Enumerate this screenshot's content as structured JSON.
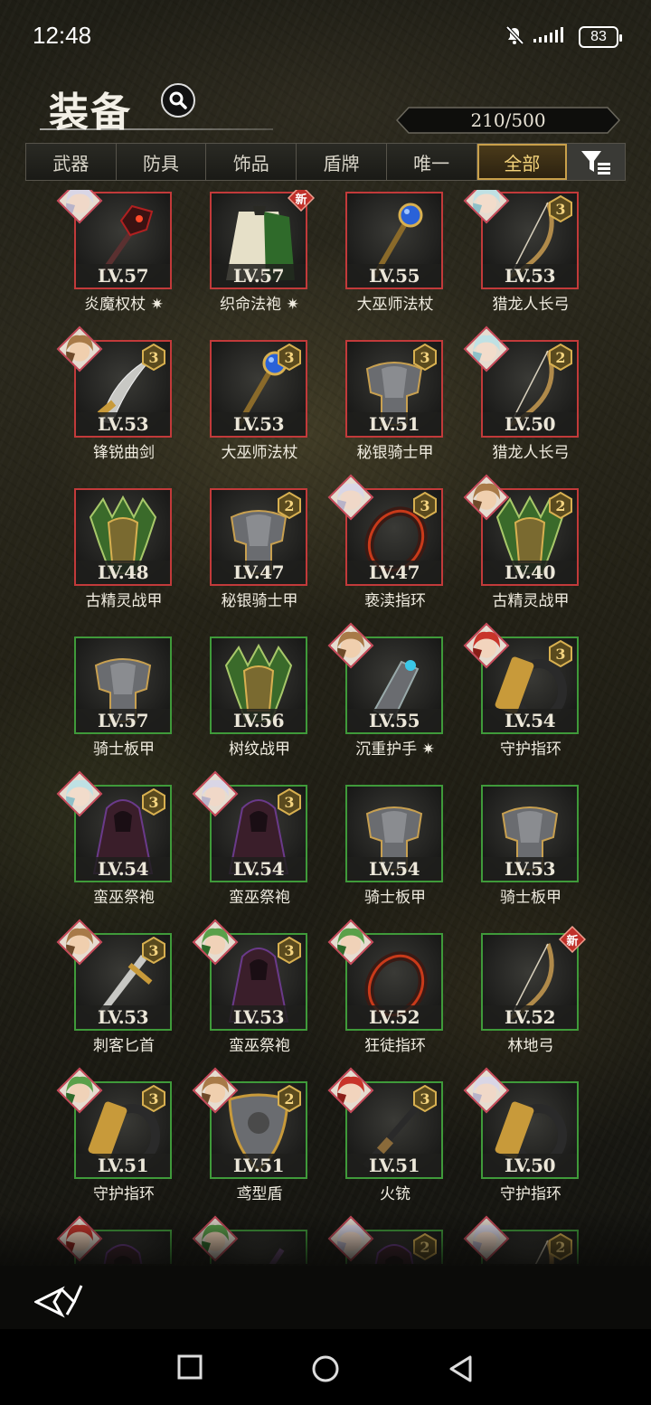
{
  "status_bar": {
    "time": "12:48",
    "battery": "83"
  },
  "header": {
    "title": "装备",
    "capacity": "210/500"
  },
  "tabs": [
    {
      "label": "武器",
      "active": false
    },
    {
      "label": "防具",
      "active": false
    },
    {
      "label": "饰品",
      "active": false
    },
    {
      "label": "盾牌",
      "active": false
    },
    {
      "label": "唯一",
      "active": false
    },
    {
      "label": "全部",
      "active": true
    }
  ],
  "colors": {
    "red_border": "#c23a3a",
    "green_border": "#3f9a3a",
    "gold": "#f3d27a",
    "new_badge": "#c0302a"
  },
  "items": [
    {
      "level": "LV.57",
      "name": "炎魔权杖",
      "sparkle": true,
      "rarity": "red",
      "avatar": "silver-hair",
      "stars": "",
      "new": false,
      "icon": "staff-demon-icon"
    },
    {
      "level": "LV.57",
      "name": "织命法袍",
      "sparkle": true,
      "rarity": "red",
      "avatar": "",
      "stars": "",
      "new": true,
      "icon": "robe-green-icon"
    },
    {
      "level": "LV.55",
      "name": "大巫师法杖",
      "sparkle": false,
      "rarity": "red",
      "avatar": "",
      "stars": "",
      "new": false,
      "icon": "staff-blue-orb-icon"
    },
    {
      "level": "LV.53",
      "name": "猎龙人长弓",
      "sparkle": false,
      "rarity": "red",
      "avatar": "teal-hair",
      "stars": "3",
      "new": false,
      "icon": "longbow-icon"
    },
    {
      "level": "LV.53",
      "name": "锋锐曲剑",
      "sparkle": false,
      "rarity": "red",
      "avatar": "brown-hair",
      "stars": "3",
      "new": false,
      "icon": "scimitar-icon"
    },
    {
      "level": "LV.53",
      "name": "大巫师法杖",
      "sparkle": false,
      "rarity": "red",
      "avatar": "",
      "stars": "3",
      "new": false,
      "icon": "staff-blue-orb-icon"
    },
    {
      "level": "LV.51",
      "name": "秘银骑士甲",
      "sparkle": false,
      "rarity": "red",
      "avatar": "",
      "stars": "3",
      "new": false,
      "icon": "mithril-armor-icon"
    },
    {
      "level": "LV.50",
      "name": "猎龙人长弓",
      "sparkle": false,
      "rarity": "red",
      "avatar": "teal-hair",
      "stars": "2",
      "new": false,
      "icon": "longbow-icon"
    },
    {
      "level": "LV.48",
      "name": "古精灵战甲",
      "sparkle": false,
      "rarity": "red",
      "avatar": "",
      "stars": "",
      "new": false,
      "icon": "elf-armor-icon"
    },
    {
      "level": "LV.47",
      "name": "秘银骑士甲",
      "sparkle": false,
      "rarity": "red",
      "avatar": "",
      "stars": "2",
      "new": false,
      "icon": "mithril-armor-icon"
    },
    {
      "level": "LV.47",
      "name": "亵渎指环",
      "sparkle": false,
      "rarity": "red",
      "avatar": "silver-hair",
      "stars": "3",
      "new": false,
      "icon": "fire-ring-icon"
    },
    {
      "level": "LV.40",
      "name": "古精灵战甲",
      "sparkle": false,
      "rarity": "red",
      "avatar": "brown-hair",
      "stars": "2",
      "new": false,
      "icon": "elf-armor-icon"
    },
    {
      "level": "LV.57",
      "name": "骑士板甲",
      "sparkle": false,
      "rarity": "green",
      "avatar": "",
      "stars": "",
      "new": false,
      "icon": "plate-armor-icon"
    },
    {
      "level": "LV.56",
      "name": "树纹战甲",
      "sparkle": false,
      "rarity": "green",
      "avatar": "",
      "stars": "",
      "new": false,
      "icon": "elf-armor-icon"
    },
    {
      "level": "LV.55",
      "name": "沉重护手",
      "sparkle": true,
      "rarity": "green",
      "avatar": "brown-hair",
      "stars": "",
      "new": false,
      "icon": "gauntlet-icon"
    },
    {
      "level": "LV.54",
      "name": "守护指环",
      "sparkle": false,
      "rarity": "green",
      "avatar": "red-hair",
      "stars": "3",
      "new": false,
      "icon": "guard-ring-icon"
    },
    {
      "level": "LV.54",
      "name": "蛮巫祭袍",
      "sparkle": false,
      "rarity": "green",
      "avatar": "teal-hair",
      "stars": "3",
      "new": false,
      "icon": "shaman-robe-icon"
    },
    {
      "level": "LV.54",
      "name": "蛮巫祭袍",
      "sparkle": false,
      "rarity": "green",
      "avatar": "silver-hair",
      "stars": "3",
      "new": false,
      "icon": "shaman-robe-icon"
    },
    {
      "level": "LV.54",
      "name": "骑士板甲",
      "sparkle": false,
      "rarity": "green",
      "avatar": "",
      "stars": "",
      "new": false,
      "icon": "plate-armor-icon"
    },
    {
      "level": "LV.53",
      "name": "骑士板甲",
      "sparkle": false,
      "rarity": "green",
      "avatar": "",
      "stars": "",
      "new": false,
      "icon": "plate-armor-icon"
    },
    {
      "level": "LV.53",
      "name": "刺客匕首",
      "sparkle": false,
      "rarity": "green",
      "avatar": "brown-hair",
      "stars": "3",
      "new": false,
      "icon": "dagger-icon"
    },
    {
      "level": "LV.53",
      "name": "蛮巫祭袍",
      "sparkle": false,
      "rarity": "green",
      "avatar": "green-hat",
      "stars": "3",
      "new": false,
      "icon": "shaman-robe-icon"
    },
    {
      "level": "LV.52",
      "name": "狂徒指环",
      "sparkle": false,
      "rarity": "green",
      "avatar": "green-hat",
      "stars": "",
      "new": false,
      "icon": "red-ring-icon"
    },
    {
      "level": "LV.52",
      "name": "林地弓",
      "sparkle": false,
      "rarity": "green",
      "avatar": "",
      "stars": "",
      "new": true,
      "icon": "woodland-bow-icon"
    },
    {
      "level": "LV.51",
      "name": "守护指环",
      "sparkle": false,
      "rarity": "green",
      "avatar": "green-hat",
      "stars": "3",
      "new": false,
      "icon": "guard-ring-icon"
    },
    {
      "level": "LV.51",
      "name": "鸢型盾",
      "sparkle": false,
      "rarity": "green",
      "avatar": "brown-hair",
      "stars": "2",
      "new": false,
      "icon": "kite-shield-icon"
    },
    {
      "level": "LV.51",
      "name": "火铳",
      "sparkle": false,
      "rarity": "green",
      "avatar": "red-hair",
      "stars": "3",
      "new": false,
      "icon": "musket-icon"
    },
    {
      "level": "LV.50",
      "name": "守护指环",
      "sparkle": false,
      "rarity": "green",
      "avatar": "silver-hair",
      "stars": "",
      "new": false,
      "icon": "guard-ring-icon"
    },
    {
      "level": "",
      "name": "",
      "sparkle": false,
      "rarity": "green",
      "avatar": "red-hair",
      "stars": "",
      "new": false,
      "icon": "shaman-robe-icon"
    },
    {
      "level": "",
      "name": "",
      "sparkle": false,
      "rarity": "green",
      "avatar": "green-hat",
      "stars": "",
      "new": false,
      "icon": "staff-icon"
    },
    {
      "level": "",
      "name": "",
      "sparkle": false,
      "rarity": "green",
      "avatar": "silver-hair",
      "stars": "2",
      "new": false,
      "icon": "shaman-robe-icon"
    },
    {
      "level": "",
      "name": "",
      "sparkle": false,
      "rarity": "green",
      "avatar": "silver-hair",
      "stars": "2",
      "new": false,
      "icon": "longbow-icon"
    }
  ],
  "new_label": "新"
}
